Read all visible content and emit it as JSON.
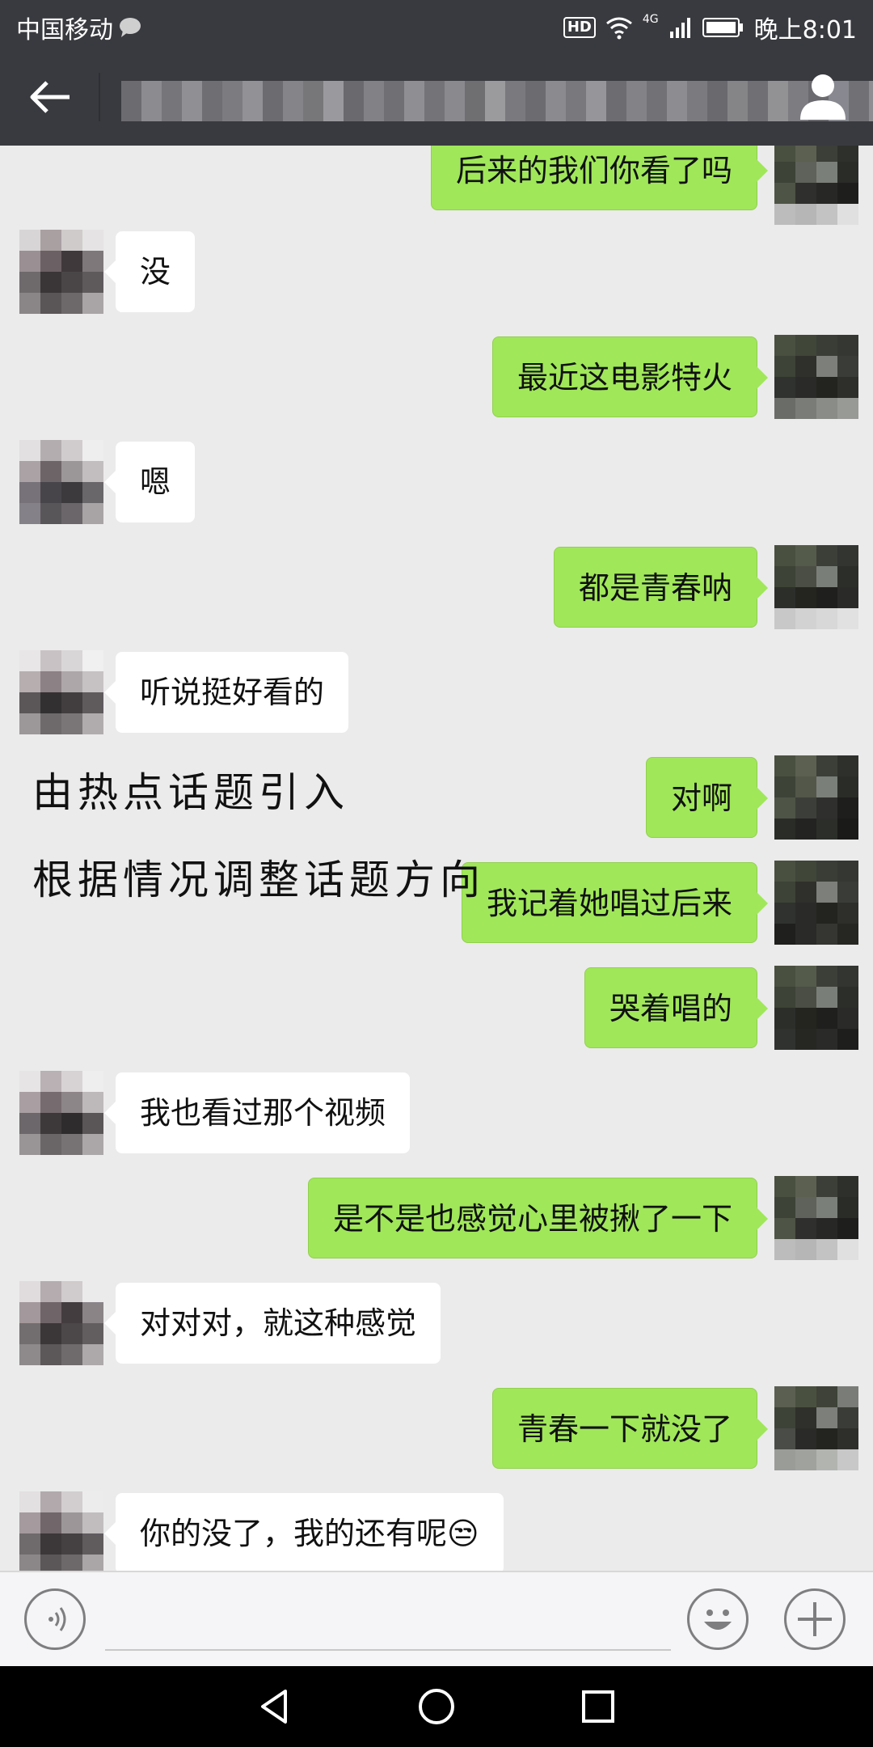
{
  "status_bar": {
    "carrier": "中国移动",
    "hd": "HD",
    "network": "4G",
    "time": "晚上8:01"
  },
  "header": {
    "back_icon": "arrow-left-icon",
    "contact_name_blurred": true,
    "profile_icon": "person-icon"
  },
  "messages": [
    {
      "side": "out",
      "text": "后来的我们你看了吗"
    },
    {
      "side": "in",
      "text": "没"
    },
    {
      "side": "out",
      "text": "最近这电影特火"
    },
    {
      "side": "in",
      "text": "嗯"
    },
    {
      "side": "out",
      "text": "都是青春呐"
    },
    {
      "side": "in",
      "text": "听说挺好看的"
    },
    {
      "side": "out",
      "text": "对啊"
    },
    {
      "side": "out",
      "text": "我记着她唱过后来"
    },
    {
      "side": "out",
      "text": "哭着唱的"
    },
    {
      "side": "in",
      "text": "我也看过那个视频"
    },
    {
      "side": "out",
      "text": "是不是也感觉心里被揪了一下"
    },
    {
      "side": "in",
      "text": "对对对，就这种感觉"
    },
    {
      "side": "out",
      "text": "青春一下就没了"
    },
    {
      "side": "in",
      "text": "你的没了，我的还有呢😒"
    }
  ],
  "annotations": [
    "由热点话题引入",
    "根据情况调整话题方向"
  ],
  "input_bar": {
    "voice_icon": "voice-icon",
    "emoji_icon": "emoji-icon",
    "more_icon": "plus-icon"
  },
  "nav_bar": {
    "back_icon": "triangle-back-icon",
    "home_icon": "circle-home-icon",
    "recents_icon": "square-recents-icon"
  },
  "colors": {
    "top_bar": "#393a3f",
    "chat_bg": "#ebebeb",
    "outgoing_bubble": "#a0e75a",
    "incoming_bubble": "#ffffff"
  }
}
